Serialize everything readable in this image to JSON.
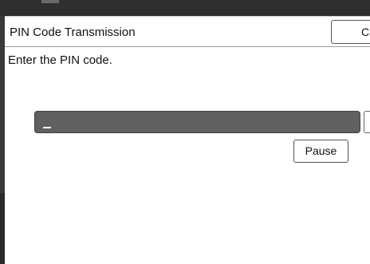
{
  "header": {
    "title": "PIN Code Transmission",
    "cancel_label": "Car"
  },
  "main": {
    "prompt": "Enter the PIN code.",
    "pin_value": "",
    "pause_label": "Pause"
  }
}
